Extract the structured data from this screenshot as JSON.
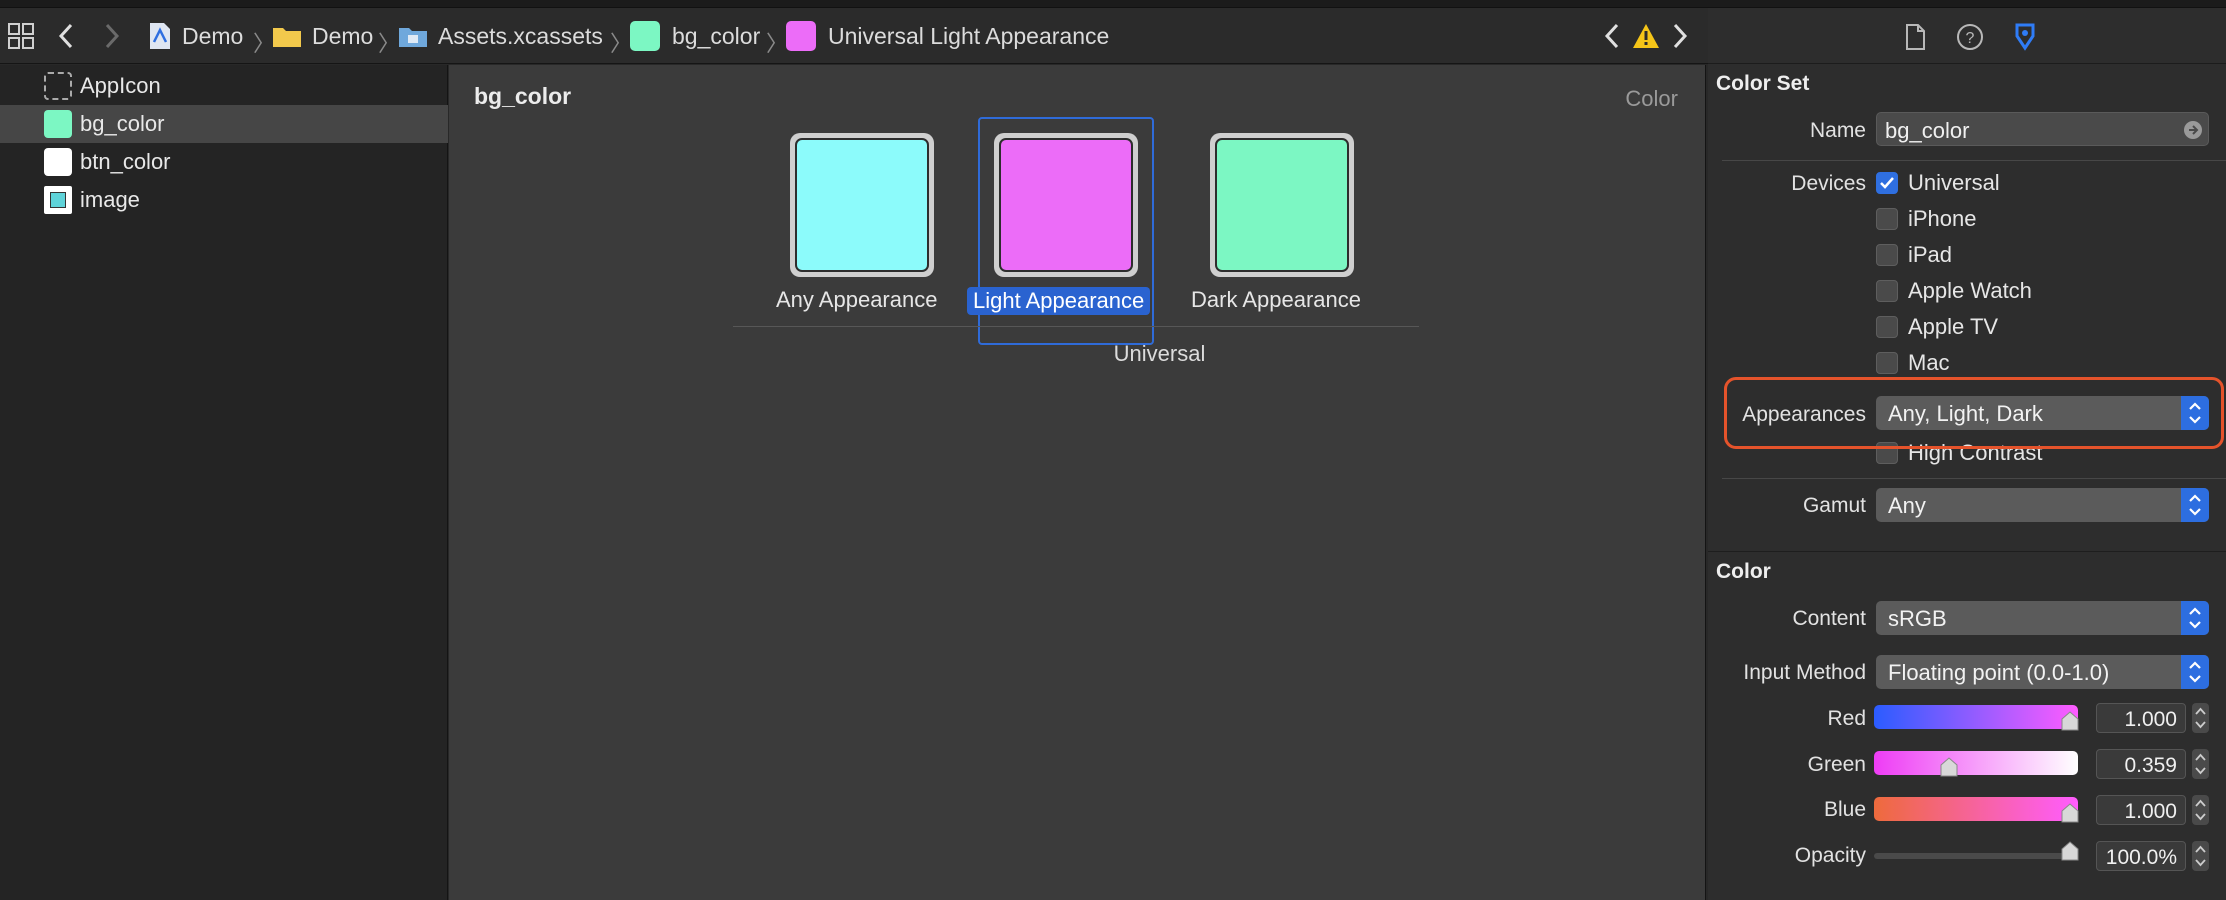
{
  "jumpbar": {
    "crumbs": [
      "Demo",
      "Demo",
      "Assets.xcassets",
      "bg_color",
      "Universal Light Appearance"
    ]
  },
  "navigator": {
    "items": [
      {
        "label": "AppIcon",
        "swatch": "appicon"
      },
      {
        "label": "bg_color",
        "swatch": "#7cf7c3"
      },
      {
        "label": "btn_color",
        "swatch": "#ffffff"
      },
      {
        "label": "image",
        "swatch": "image"
      }
    ]
  },
  "editor": {
    "title": "bg_color",
    "kind": "Color",
    "wells": [
      {
        "label": "Any Appearance",
        "color": "#8cfbfb"
      },
      {
        "label": "Light Appearance",
        "color": "#ec6cf8"
      },
      {
        "label": "Dark Appearance",
        "color": "#7cf7c3"
      }
    ],
    "group_label": "Universal"
  },
  "inspector": {
    "color_set_title": "Color Set",
    "name_label": "Name",
    "name_value": "bg_color",
    "devices_label": "Devices",
    "devices": [
      {
        "label": "Universal",
        "checked": true
      },
      {
        "label": "iPhone",
        "checked": false
      },
      {
        "label": "iPad",
        "checked": false
      },
      {
        "label": "Apple Watch",
        "checked": false
      },
      {
        "label": "Apple TV",
        "checked": false
      },
      {
        "label": "Mac",
        "checked": false
      }
    ],
    "appearances_label": "Appearances",
    "appearances_value": "Any, Light, Dark",
    "high_contrast_label": "High Contrast",
    "gamut_label": "Gamut",
    "gamut_value": "Any",
    "color_title": "Color",
    "content_label": "Content",
    "content_value": "sRGB",
    "input_method_label": "Input Method",
    "input_method_value": "Floating point (0.0-1.0)",
    "red_label": "Red",
    "red_value": "1.000",
    "green_label": "Green",
    "green_value": "0.359",
    "blue_label": "Blue",
    "blue_value": "1.000",
    "opacity_label": "Opacity",
    "opacity_value": "100.0%"
  },
  "colors": {
    "accent": "#2f6fe0",
    "highlight": "#e5532b"
  }
}
